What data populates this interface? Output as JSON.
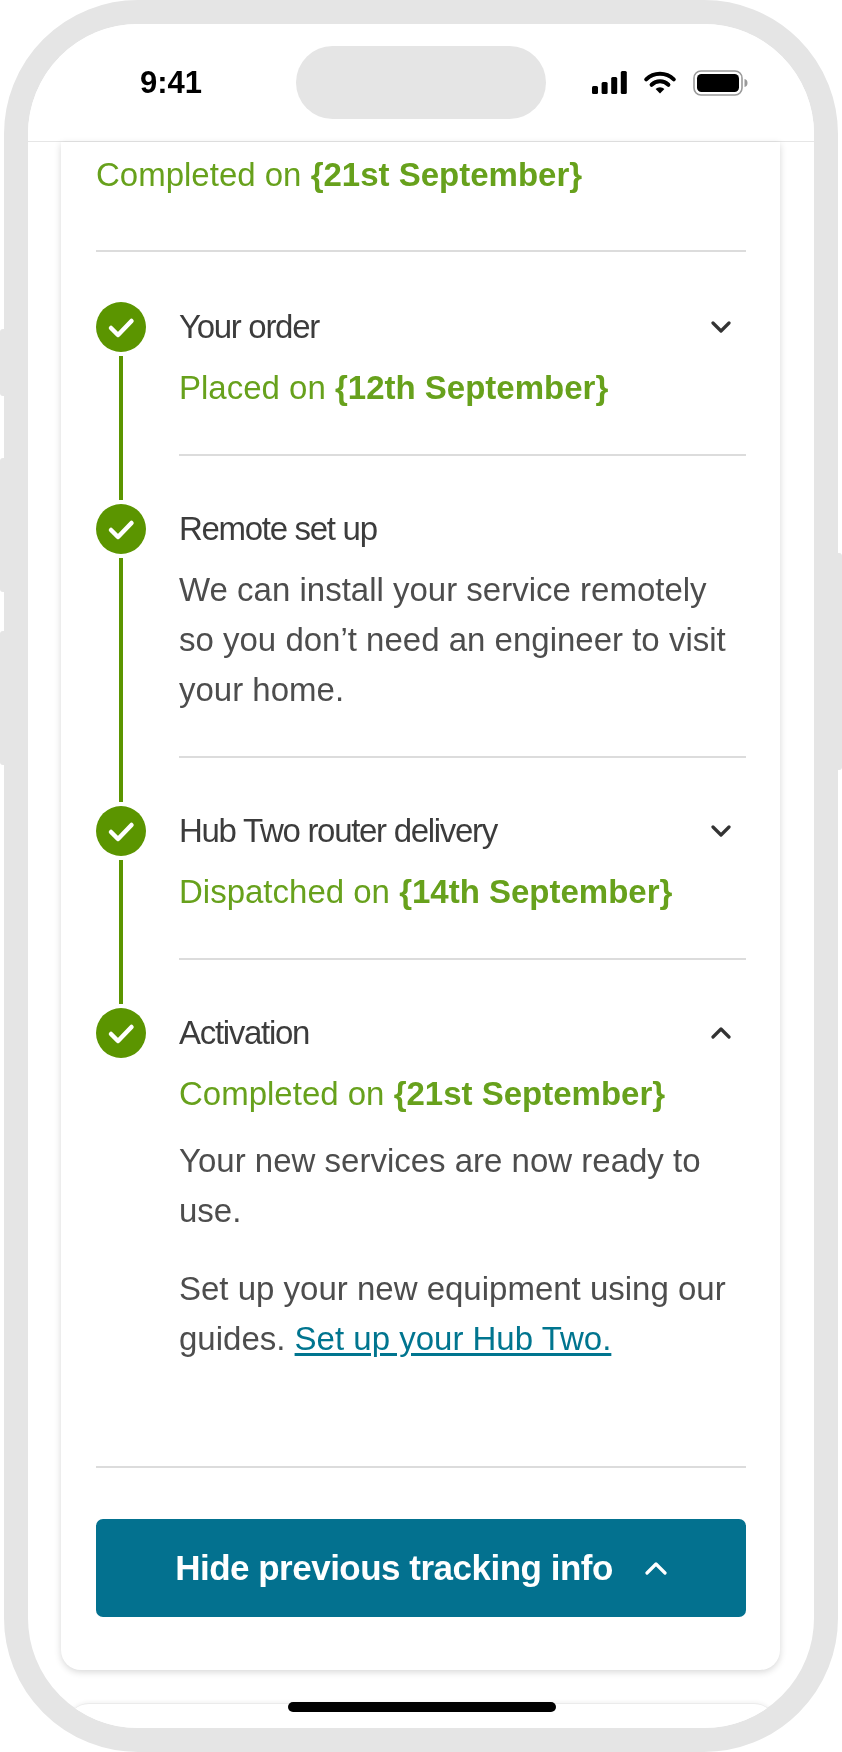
{
  "status_bar": {
    "time": "9:41"
  },
  "previous_stage": {
    "status": "Completed on **{21st September}**"
  },
  "steps": [
    {
      "kind": "collapsible",
      "title": "Your order",
      "completed": true,
      "expanded": false,
      "status": "Placed on **{12th September}**"
    },
    {
      "kind": "static",
      "title": "Remote set up",
      "completed": true,
      "expanded": true,
      "details": [
        {
          "text": "We can install your service remotely so you don’t need an engineer to visit your home."
        }
      ]
    },
    {
      "kind": "collapsible",
      "title": "Hub Two router delivery",
      "completed": true,
      "expanded": false,
      "status": "Dispatched on **{14th September}**"
    },
    {
      "kind": "collapsible",
      "title": "Activation",
      "completed": true,
      "expanded": true,
      "status": "Completed on **{21st September}**",
      "details": [
        {
          "text": "Your new services are now ready to use."
        },
        {
          "text": "Set up your new equipment using our guides.",
          "link": "Set up your Hub Two."
        }
      ]
    }
  ],
  "toggle_button": {
    "label": "Hide previous tracking info",
    "expanded": true
  }
}
